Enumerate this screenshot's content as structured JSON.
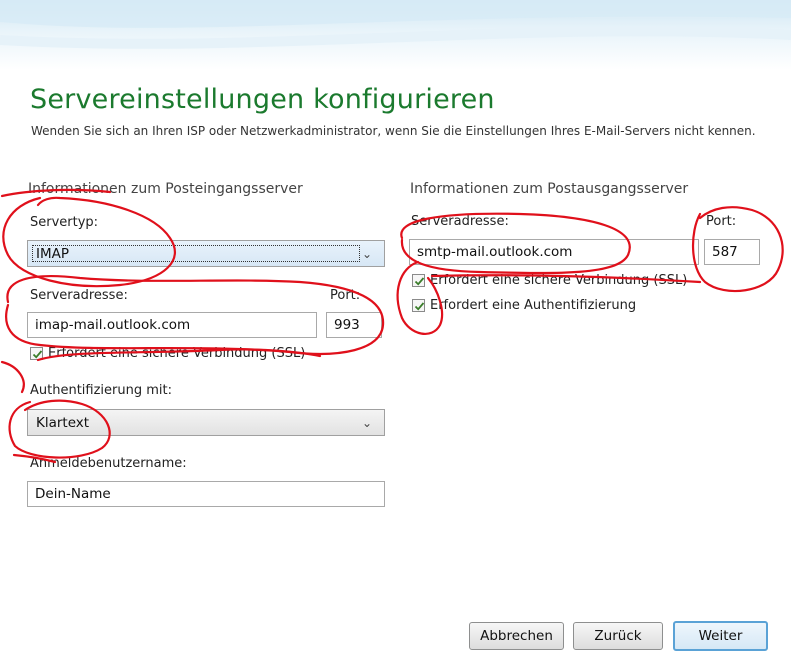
{
  "header": {
    "title": "Servereinstellungen konfigurieren",
    "subtitle": "Wenden Sie sich an Ihren ISP oder Netzwerkadministrator, wenn Sie die Einstellungen Ihres E-Mail-Servers nicht kennen."
  },
  "incoming": {
    "section_title": "Informationen zum Posteingangsserver",
    "server_type_label": "Servertyp:",
    "server_type_value": "IMAP",
    "server_address_label": "Serveradresse:",
    "server_address_value": "imap-mail.outlook.com",
    "port_label": "Port:",
    "port_value": "993",
    "ssl_label": "Erfordert eine sichere Verbindung (SSL)",
    "ssl_checked": true,
    "auth_label": "Authentifizierung mit:",
    "auth_value": "Klartext",
    "username_label": "Anmeldebenutzername:",
    "username_value": "Dein-Name"
  },
  "outgoing": {
    "section_title": "Informationen zum Postausgangsserver",
    "server_address_label": "Serveradresse:",
    "server_address_value": "smtp-mail.outlook.com",
    "port_label": "Port:",
    "port_value": "587",
    "ssl_label": "Erfordert eine sichere Verbindung (SSL)",
    "ssl_checked": true,
    "auth_label": "Erfordert eine Authentifizierung",
    "auth_checked": true
  },
  "buttons": {
    "cancel": "Abbrechen",
    "back": "Zurück",
    "next": "Weiter"
  },
  "colors": {
    "title": "#1b7a2e",
    "annotation": "#e0101b",
    "default_button_border": "#5aa2d6"
  },
  "icons": {
    "dropdown": "chevron-down-icon",
    "checkbox": "checkmark-icon"
  }
}
